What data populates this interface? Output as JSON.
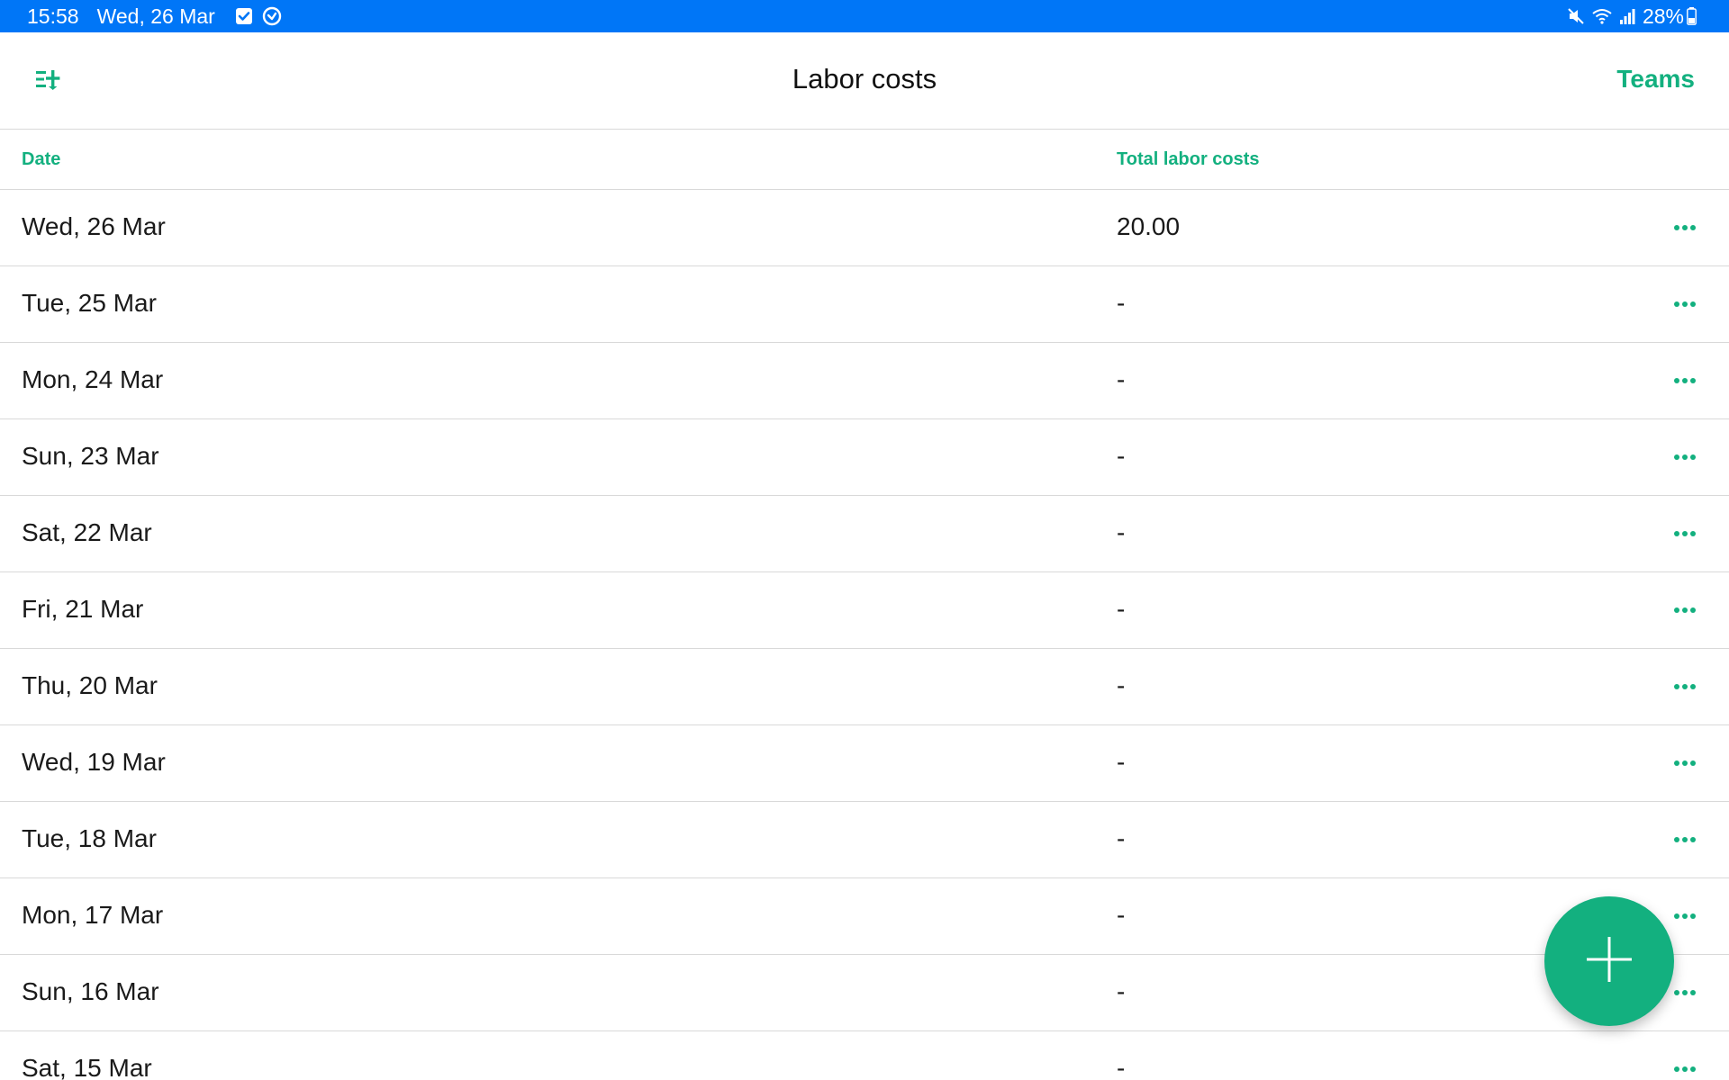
{
  "status_bar": {
    "time": "15:58",
    "date": "Wed, 26 Mar",
    "battery": "28%",
    "left_icons": [
      "checkbox-notification-icon",
      "sync-circle-icon"
    ],
    "right_icons": [
      "mute-icon",
      "wifi-icon",
      "signal-icon",
      "battery-icon"
    ],
    "background": "#0076f7"
  },
  "header": {
    "title": "Labor costs",
    "teams_label": "Teams",
    "filter_icon": "filter-plus-icon"
  },
  "table": {
    "columns": {
      "date": "Date",
      "total": "Total labor costs"
    },
    "rows": [
      {
        "date": "Wed, 26 Mar",
        "total": "20.00"
      },
      {
        "date": "Tue, 25 Mar",
        "total": "-"
      },
      {
        "date": "Mon, 24 Mar",
        "total": "-"
      },
      {
        "date": "Sun, 23 Mar",
        "total": "-"
      },
      {
        "date": "Sat, 22 Mar",
        "total": "-"
      },
      {
        "date": "Fri, 21 Mar",
        "total": "-"
      },
      {
        "date": "Thu, 20 Mar",
        "total": "-"
      },
      {
        "date": "Wed, 19 Mar",
        "total": "-"
      },
      {
        "date": "Tue, 18 Mar",
        "total": "-"
      },
      {
        "date": "Mon, 17 Mar",
        "total": "-"
      },
      {
        "date": "Sun, 16 Mar",
        "total": "-"
      },
      {
        "date": "Sat, 15 Mar",
        "total": "-"
      }
    ],
    "row_action_icon": "more-horizontal-icon"
  },
  "fab": {
    "icon": "plus-icon"
  },
  "colors": {
    "accent": "#13b07f",
    "divider": "#d9d9d9",
    "text": "#1a1a1a"
  }
}
